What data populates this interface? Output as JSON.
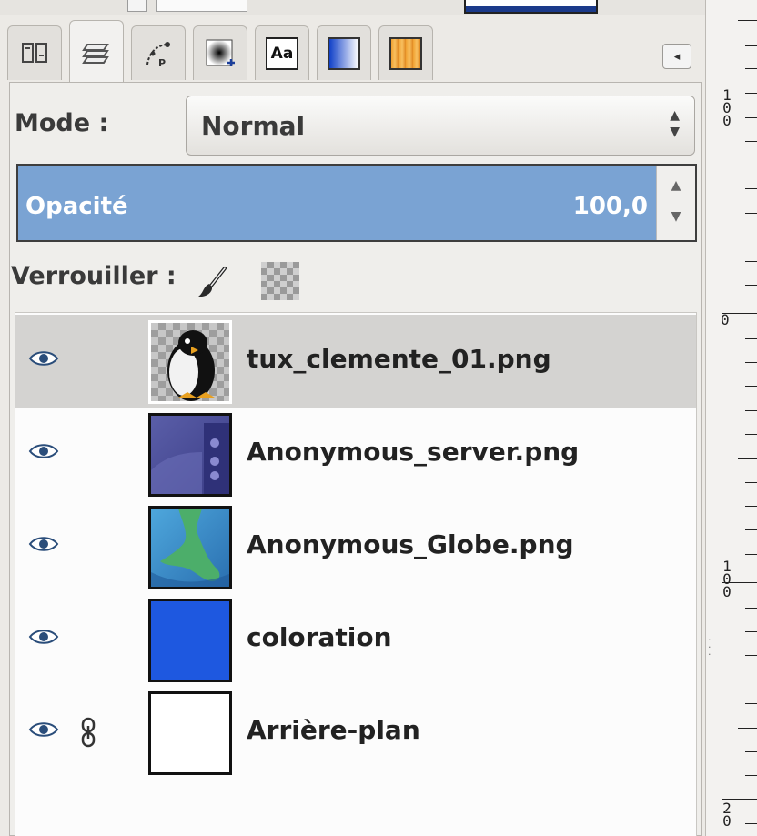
{
  "tabs": [
    {
      "icon": "device-status-icon"
    },
    {
      "icon": "layers-icon"
    },
    {
      "icon": "paths-icon"
    },
    {
      "icon": "brushes-icon"
    },
    {
      "icon": "fonts-icon",
      "text": "Aa"
    },
    {
      "icon": "gradient-icon"
    },
    {
      "icon": "palette-icon"
    }
  ],
  "mode": {
    "label": "Mode :",
    "value": "Normal"
  },
  "opacity": {
    "label": "Opacité",
    "value": "100,0",
    "level": 1.0
  },
  "lock": {
    "label": "Verrouiller :"
  },
  "layers": [
    {
      "name": "tux_clemente_01.png",
      "selected": true,
      "linked": false
    },
    {
      "name": "Anonymous_server.png",
      "selected": false,
      "linked": false
    },
    {
      "name": "Anonymous_Globe.png",
      "selected": false,
      "linked": false
    },
    {
      "name": "coloration",
      "selected": false,
      "linked": false
    },
    {
      "name": "Arrière-plan",
      "selected": false,
      "linked": true
    }
  ],
  "ruler": {
    "marks": [
      "100",
      "0",
      "100",
      "20"
    ]
  },
  "colors": {
    "selection": "#d4d3d1",
    "opacity_fill": "#7aa3d3",
    "coloration": "#1e58e0"
  }
}
